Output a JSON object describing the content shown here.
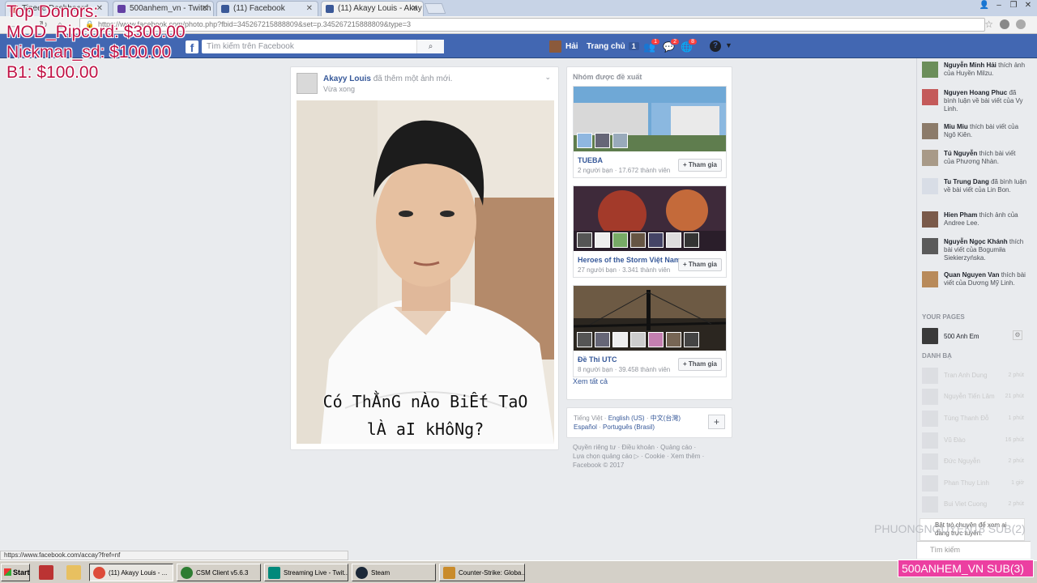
{
  "browser": {
    "tabs": [
      {
        "label": "Tipeee Dashboard",
        "active": false,
        "color": "#d9534f"
      },
      {
        "label": "500anhem_vn - Twitch",
        "active": false,
        "color": "#6441a4"
      },
      {
        "label": "(11) Facebook",
        "active": false,
        "color": "#3b5998"
      },
      {
        "label": "(11) Akayy Louis - Akay",
        "active": true,
        "color": "#3b5998"
      }
    ],
    "url": "https://www.facebook.com/photo.php?fbid=345267215888809&set=p.345267215888809&type=3",
    "status_url": "https://www.facebook.com/accay?fref=nf"
  },
  "overlay": {
    "donors": [
      "Top Donors:",
      "MOD_Ripcord: $300.00",
      "Nickman_sd: $100.00",
      "B1: $100.00"
    ],
    "watermark": "PHUONGNGUYEN18 SUB(2)",
    "sub_badge": "500ANHEM_VN SUB(3)"
  },
  "fb": {
    "search_placeholder": "Tìm kiếm trên Facebook",
    "user_name": "Hải",
    "home_label": "Trang chủ",
    "home_count": "1",
    "badges": {
      "friends": "1",
      "messages": "2",
      "notifications": "8"
    },
    "help": "?"
  },
  "post": {
    "author": "Akayy Louis",
    "action": "đã thêm một ảnh mới.",
    "time": "Vừa xong",
    "caption_line1": "Có ThẰnG nÀo BiẾt TaO",
    "caption_line2": "lÀ aI kHôNg?"
  },
  "groups": {
    "title": "Nhóm được đề xuất",
    "join_label": "+ Tham gia",
    "items": [
      {
        "name": "TUEBA",
        "meta": "2 người bạn · 17.672 thành viên"
      },
      {
        "name": "Heroes of the Storm Việt Nam",
        "meta": "27 người bạn · 3.341 thành viên"
      },
      {
        "name": "Đề Thi UTC",
        "meta": "8 người bạn · 39.458 thành viên"
      }
    ],
    "see_all": "Xem tất cả"
  },
  "languages": {
    "current": "Tiếng Việt",
    "options": [
      "English (US)",
      "中文(台灣)",
      "Español",
      "Português (Brasil)"
    ]
  },
  "footer": {
    "line1": "Quyền riêng tư · Điều khoản · Quảng cáo ·",
    "line2": "Lựa chọn quảng cáo ▷ · Cookie · Xem thêm ·",
    "line3": "Facebook © 2017"
  },
  "ticker": [
    {
      "name": "Nguyễn Minh Hải",
      "text": "thích ảnh của Huyền Milzu."
    },
    {
      "name": "Nguyen Hoang Phuc",
      "text": "đã bình luận về bài viết của Vy Linh."
    },
    {
      "name": "Miu Miu",
      "text": "thích bài viết của Ngô Kiên."
    },
    {
      "name": "Tú Nguyễn",
      "text": "thích bài viết của Phương Nhàn."
    },
    {
      "name": "Tu Trung Dang",
      "text": "đã bình luận về bài viết của Lin Bon."
    },
    {
      "name": "Hien Pham",
      "text": "thích ảnh của Andree Lee."
    },
    {
      "name": "Nguyễn Ngọc Khánh",
      "text": "thích bài viết của Bogumiła Siekierzyńska."
    },
    {
      "name": "Quan Nguyen Van",
      "text": "thích bài viết của Dương Mỹ Linh."
    }
  ],
  "sidebar": {
    "pages_header": "YOUR PAGES",
    "page_name": "500 Anh Em",
    "contacts_header": "DANH BẠ",
    "contacts": [
      {
        "name": "Tran Anh Dung",
        "time": "2 phút"
      },
      {
        "name": "Nguyễn Tiến Lâm",
        "time": "21 phút"
      },
      {
        "name": "Tùng Thanh Đỗ",
        "time": "1 phút"
      },
      {
        "name": "Vũ Đào",
        "time": "16 phút"
      },
      {
        "name": "Đức Nguyễn",
        "time": "2 phút"
      },
      {
        "name": "Phan Thuy Linh",
        "time": "1 giờ"
      },
      {
        "name": "Bui Viet Cuong",
        "time": "2 phút"
      }
    ],
    "notice": "Bật trò chuyện để xem ai đang trực tuyến.",
    "search": "Tìm kiếm"
  },
  "taskbar": {
    "start": "Start",
    "items": [
      {
        "label": "(11) Akayy Louis - ...",
        "color": "#dd4b39",
        "active": true
      },
      {
        "label": "CSM Client v5.6.3",
        "color": "#2e7d32",
        "active": false
      },
      {
        "label": "Streaming Live - Twit...",
        "color": "#00897b",
        "active": false
      },
      {
        "label": "Steam",
        "color": "#1b2838",
        "active": false
      },
      {
        "label": "Counter-Strike: Globa...",
        "color": "#c98b2b",
        "active": false
      }
    ]
  }
}
